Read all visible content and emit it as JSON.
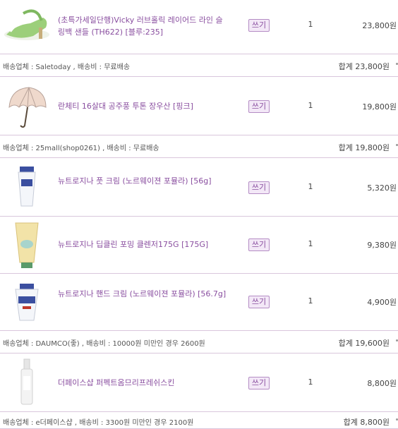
{
  "items": [
    {
      "name": "(초특가세일단행)Vicky 러브홀릭 레이어드 라인 슬링백 샌들 (TH622) [블루:235]",
      "icon": "sandal-icon",
      "write_label": "쓰기",
      "qty": "1",
      "price": "23,800원"
    },
    {
      "name": "란체티 16살대 공주풍 투톤 장우산 [핑크]",
      "icon": "umbrella-icon",
      "write_label": "쓰기",
      "qty": "1",
      "price": "19,800원"
    },
    {
      "name": "뉴트로지나 풋 크림 (노르웨이젼 포뮬라) [56g]",
      "icon": "cream-tube-icon",
      "write_label": "쓰기",
      "qty": "1",
      "price": "5,320원"
    },
    {
      "name": "뉴트로지나 딥클린 포밍 클렌저175G [175G]",
      "icon": "cleanser-tube-icon",
      "write_label": "쓰기",
      "qty": "1",
      "price": "9,380원"
    },
    {
      "name": "뉴트로지나 핸드 크림 (노르웨이젼 포뮬라) [56.7g]",
      "icon": "hand-cream-icon",
      "write_label": "쓰기",
      "qty": "1",
      "price": "4,900원"
    },
    {
      "name": "더페이스샵 퍼펙트옴므리프레쉬스킨",
      "icon": "skin-bottle-icon",
      "write_label": "쓰기",
      "qty": "1",
      "price": "8,800원"
    }
  ],
  "shipping": [
    {
      "info": "배송업체 : Saletoday , 배송비 : 무료배송",
      "total_label": "합계",
      "total": "23,800원"
    },
    {
      "info": "배송업체 : 25mall(shop0261) , 배송비 : 무료배송",
      "total_label": "합계",
      "total": "19,800원"
    },
    {
      "info": "배송업체 : DAUMCO(좋) , 배송비 : 10000원 미만인 경우 2600원",
      "total_label": "합계",
      "total": "19,600원"
    },
    {
      "info": "배송업체 : e더페이스샵 , 배송비 : 3300원 미만인 경우 2100원",
      "total_label": "합계",
      "total": "8,800원"
    }
  ]
}
